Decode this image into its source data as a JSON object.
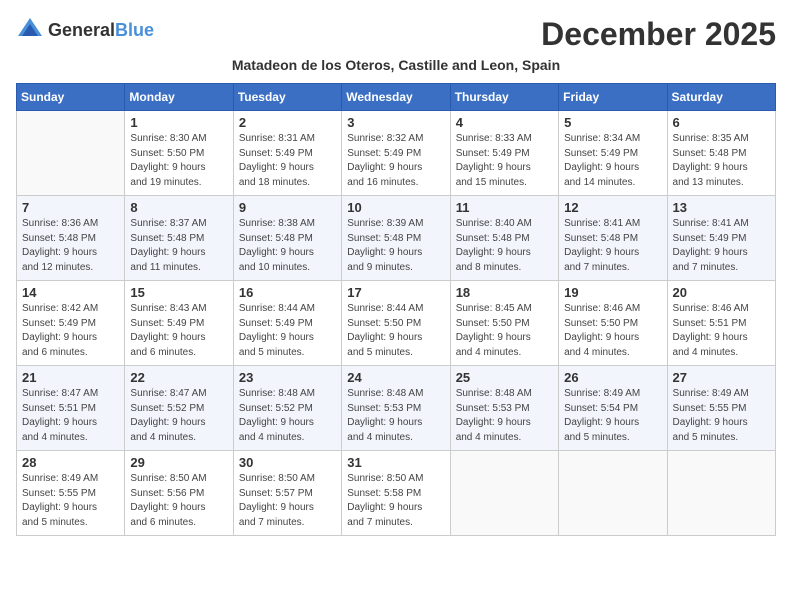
{
  "logo": {
    "general": "General",
    "blue": "Blue"
  },
  "title": "December 2025",
  "subtitle": "Matadeon de los Oteros, Castille and Leon, Spain",
  "days_of_week": [
    "Sunday",
    "Monday",
    "Tuesday",
    "Wednesday",
    "Thursday",
    "Friday",
    "Saturday"
  ],
  "weeks": [
    [
      {
        "day": "",
        "info": ""
      },
      {
        "day": "1",
        "info": "Sunrise: 8:30 AM\nSunset: 5:50 PM\nDaylight: 9 hours\nand 19 minutes."
      },
      {
        "day": "2",
        "info": "Sunrise: 8:31 AM\nSunset: 5:49 PM\nDaylight: 9 hours\nand 18 minutes."
      },
      {
        "day": "3",
        "info": "Sunrise: 8:32 AM\nSunset: 5:49 PM\nDaylight: 9 hours\nand 16 minutes."
      },
      {
        "day": "4",
        "info": "Sunrise: 8:33 AM\nSunset: 5:49 PM\nDaylight: 9 hours\nand 15 minutes."
      },
      {
        "day": "5",
        "info": "Sunrise: 8:34 AM\nSunset: 5:49 PM\nDaylight: 9 hours\nand 14 minutes."
      },
      {
        "day": "6",
        "info": "Sunrise: 8:35 AM\nSunset: 5:48 PM\nDaylight: 9 hours\nand 13 minutes."
      }
    ],
    [
      {
        "day": "7",
        "info": "Sunrise: 8:36 AM\nSunset: 5:48 PM\nDaylight: 9 hours\nand 12 minutes."
      },
      {
        "day": "8",
        "info": "Sunrise: 8:37 AM\nSunset: 5:48 PM\nDaylight: 9 hours\nand 11 minutes."
      },
      {
        "day": "9",
        "info": "Sunrise: 8:38 AM\nSunset: 5:48 PM\nDaylight: 9 hours\nand 10 minutes."
      },
      {
        "day": "10",
        "info": "Sunrise: 8:39 AM\nSunset: 5:48 PM\nDaylight: 9 hours\nand 9 minutes."
      },
      {
        "day": "11",
        "info": "Sunrise: 8:40 AM\nSunset: 5:48 PM\nDaylight: 9 hours\nand 8 minutes."
      },
      {
        "day": "12",
        "info": "Sunrise: 8:41 AM\nSunset: 5:48 PM\nDaylight: 9 hours\nand 7 minutes."
      },
      {
        "day": "13",
        "info": "Sunrise: 8:41 AM\nSunset: 5:49 PM\nDaylight: 9 hours\nand 7 minutes."
      }
    ],
    [
      {
        "day": "14",
        "info": "Sunrise: 8:42 AM\nSunset: 5:49 PM\nDaylight: 9 hours\nand 6 minutes."
      },
      {
        "day": "15",
        "info": "Sunrise: 8:43 AM\nSunset: 5:49 PM\nDaylight: 9 hours\nand 6 minutes."
      },
      {
        "day": "16",
        "info": "Sunrise: 8:44 AM\nSunset: 5:49 PM\nDaylight: 9 hours\nand 5 minutes."
      },
      {
        "day": "17",
        "info": "Sunrise: 8:44 AM\nSunset: 5:50 PM\nDaylight: 9 hours\nand 5 minutes."
      },
      {
        "day": "18",
        "info": "Sunrise: 8:45 AM\nSunset: 5:50 PM\nDaylight: 9 hours\nand 4 minutes."
      },
      {
        "day": "19",
        "info": "Sunrise: 8:46 AM\nSunset: 5:50 PM\nDaylight: 9 hours\nand 4 minutes."
      },
      {
        "day": "20",
        "info": "Sunrise: 8:46 AM\nSunset: 5:51 PM\nDaylight: 9 hours\nand 4 minutes."
      }
    ],
    [
      {
        "day": "21",
        "info": "Sunrise: 8:47 AM\nSunset: 5:51 PM\nDaylight: 9 hours\nand 4 minutes."
      },
      {
        "day": "22",
        "info": "Sunrise: 8:47 AM\nSunset: 5:52 PM\nDaylight: 9 hours\nand 4 minutes."
      },
      {
        "day": "23",
        "info": "Sunrise: 8:48 AM\nSunset: 5:52 PM\nDaylight: 9 hours\nand 4 minutes."
      },
      {
        "day": "24",
        "info": "Sunrise: 8:48 AM\nSunset: 5:53 PM\nDaylight: 9 hours\nand 4 minutes."
      },
      {
        "day": "25",
        "info": "Sunrise: 8:48 AM\nSunset: 5:53 PM\nDaylight: 9 hours\nand 4 minutes."
      },
      {
        "day": "26",
        "info": "Sunrise: 8:49 AM\nSunset: 5:54 PM\nDaylight: 9 hours\nand 5 minutes."
      },
      {
        "day": "27",
        "info": "Sunrise: 8:49 AM\nSunset: 5:55 PM\nDaylight: 9 hours\nand 5 minutes."
      }
    ],
    [
      {
        "day": "28",
        "info": "Sunrise: 8:49 AM\nSunset: 5:55 PM\nDaylight: 9 hours\nand 5 minutes."
      },
      {
        "day": "29",
        "info": "Sunrise: 8:50 AM\nSunset: 5:56 PM\nDaylight: 9 hours\nand 6 minutes."
      },
      {
        "day": "30",
        "info": "Sunrise: 8:50 AM\nSunset: 5:57 PM\nDaylight: 9 hours\nand 7 minutes."
      },
      {
        "day": "31",
        "info": "Sunrise: 8:50 AM\nSunset: 5:58 PM\nDaylight: 9 hours\nand 7 minutes."
      },
      {
        "day": "",
        "info": ""
      },
      {
        "day": "",
        "info": ""
      },
      {
        "day": "",
        "info": ""
      }
    ]
  ]
}
